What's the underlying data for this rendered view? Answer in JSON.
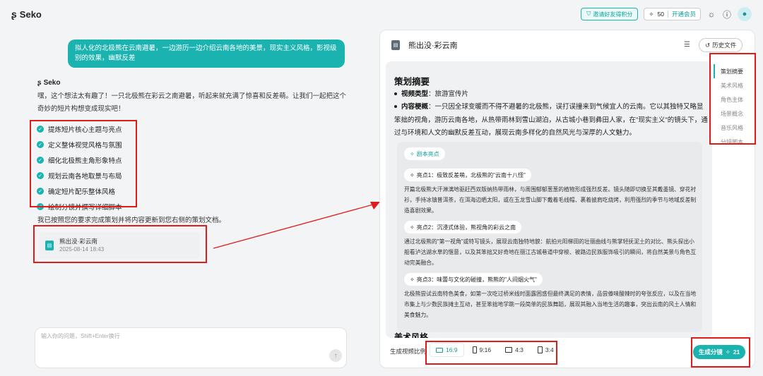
{
  "app": {
    "name": "Seko",
    "invite_label": "邀请好友得积分",
    "points": "50",
    "member_label": "开通会员"
  },
  "chat": {
    "user_message": "拟人化的北极熊在云南避暑，一边游历一边介绍云南各地的美景，现实主义风格，影视级别的效果，幽默反差",
    "ai_name": "Seko",
    "ai_intro": "嘿，这个想法太有趣了！一只北极熊在彩云之南避暑，听起来就充满了惊喜和反差萌。让我们一起把这个奇妙的短片构想变成现实吧！",
    "steps": [
      "提炼短片核心主题与亮点",
      "定义整体视觉风格与氛围",
      "细化北极熊主角形象特点",
      "规划云南各地取景与布局",
      "确定短片配乐整体风格",
      "绘制分镜并撰写详细脚本"
    ],
    "ai_done": "我已按照您的要求完成策划并将内容更新到您右侧的策划文档。",
    "file": {
      "title": "熊出没·彩云南",
      "date": "2025-08-14 18:43"
    },
    "input_placeholder": "输入你的问题，Shift+Enter换行"
  },
  "panel": {
    "title": "熊出没·彩云南",
    "history_label": "历史文件",
    "section_title": "策划摘要",
    "video_type_label": "视频类型",
    "video_type_value": "旅游宣传片",
    "content_label": "内容梗概",
    "content_value": "一只因全球变暖而不得不避暑的北极熊，误打误撞来到气候宜人的云南。它以其独特又略显笨拙的视角，游历云南各地，从热带雨林到雪山湖泊，从古城小巷到彝田人家，在\"现实主义\"的镜头下，通过与环境和人文的幽默反差互动，展现云南多样化的自然风光与深厚的人文魅力。",
    "highlights_tag": "剧本亮点",
    "highlights": [
      {
        "title": "亮点1：极致反差萌，北极熊的\"云南十八怪\"",
        "text": "开篇北极熊大汗淋漓地驱赶西双版纳热带雨林，与周围郁郁葱葱的植物形成强烈反差。镜头随即切换至其戴墨镜、穿花衬衫，手持冰镇普洱茶，在洱海边晒太阳，或在玉龙雪山脚下戴着毛线帽、裹着披肩吃烧烤，利用强烈的季节与地域反差制造喜剧效果。"
      },
      {
        "title": "亮点2：沉浸式体验，熊视角的彩云之南",
        "text": "通过北极熊的\"第一视角\"或特写镜头，展现云南独特地貌：航拍元阳梯田的壮丽曲线与熊掌轻抚泥土的对比、熊头探出小船看泸沽湖水草的惬意，以及其笨拙又好奇地在丽江古城巷道中穿梭、被路边民族服饰吸引的瞬间，将自然美景与角色互动完美融合。"
      },
      {
        "title": "亮点3：味蕾与文化的碰撞，熊熊的\"人间烟火气\"",
        "text": "北极熊尝试云南特色美食，如第一次吃过桥米线时面露困惑但最终满足的表情，品尝傣味酸辣时的夸张反应，以及在当地市集上与少数民族摊主互动，甚至笨拙地学跳一段简单的民族舞蹈，展现其融入当地生活的趣事，突出云南的风土人情和美食魅力。"
      }
    ],
    "next_section": "美术风格",
    "toc": [
      "策划摘要",
      "美术风格",
      "角色主体",
      "场景概念",
      "音乐风格",
      "分镜脚本"
    ],
    "ratio_label": "生成视频比例",
    "ratios": [
      "16:9",
      "9:16",
      "4:3",
      "3:4"
    ],
    "generate_label": "生成分镜",
    "generate_cost": "21"
  },
  "colors": {
    "accent": "#1bb3b0",
    "annotation": "#e01b1b"
  }
}
